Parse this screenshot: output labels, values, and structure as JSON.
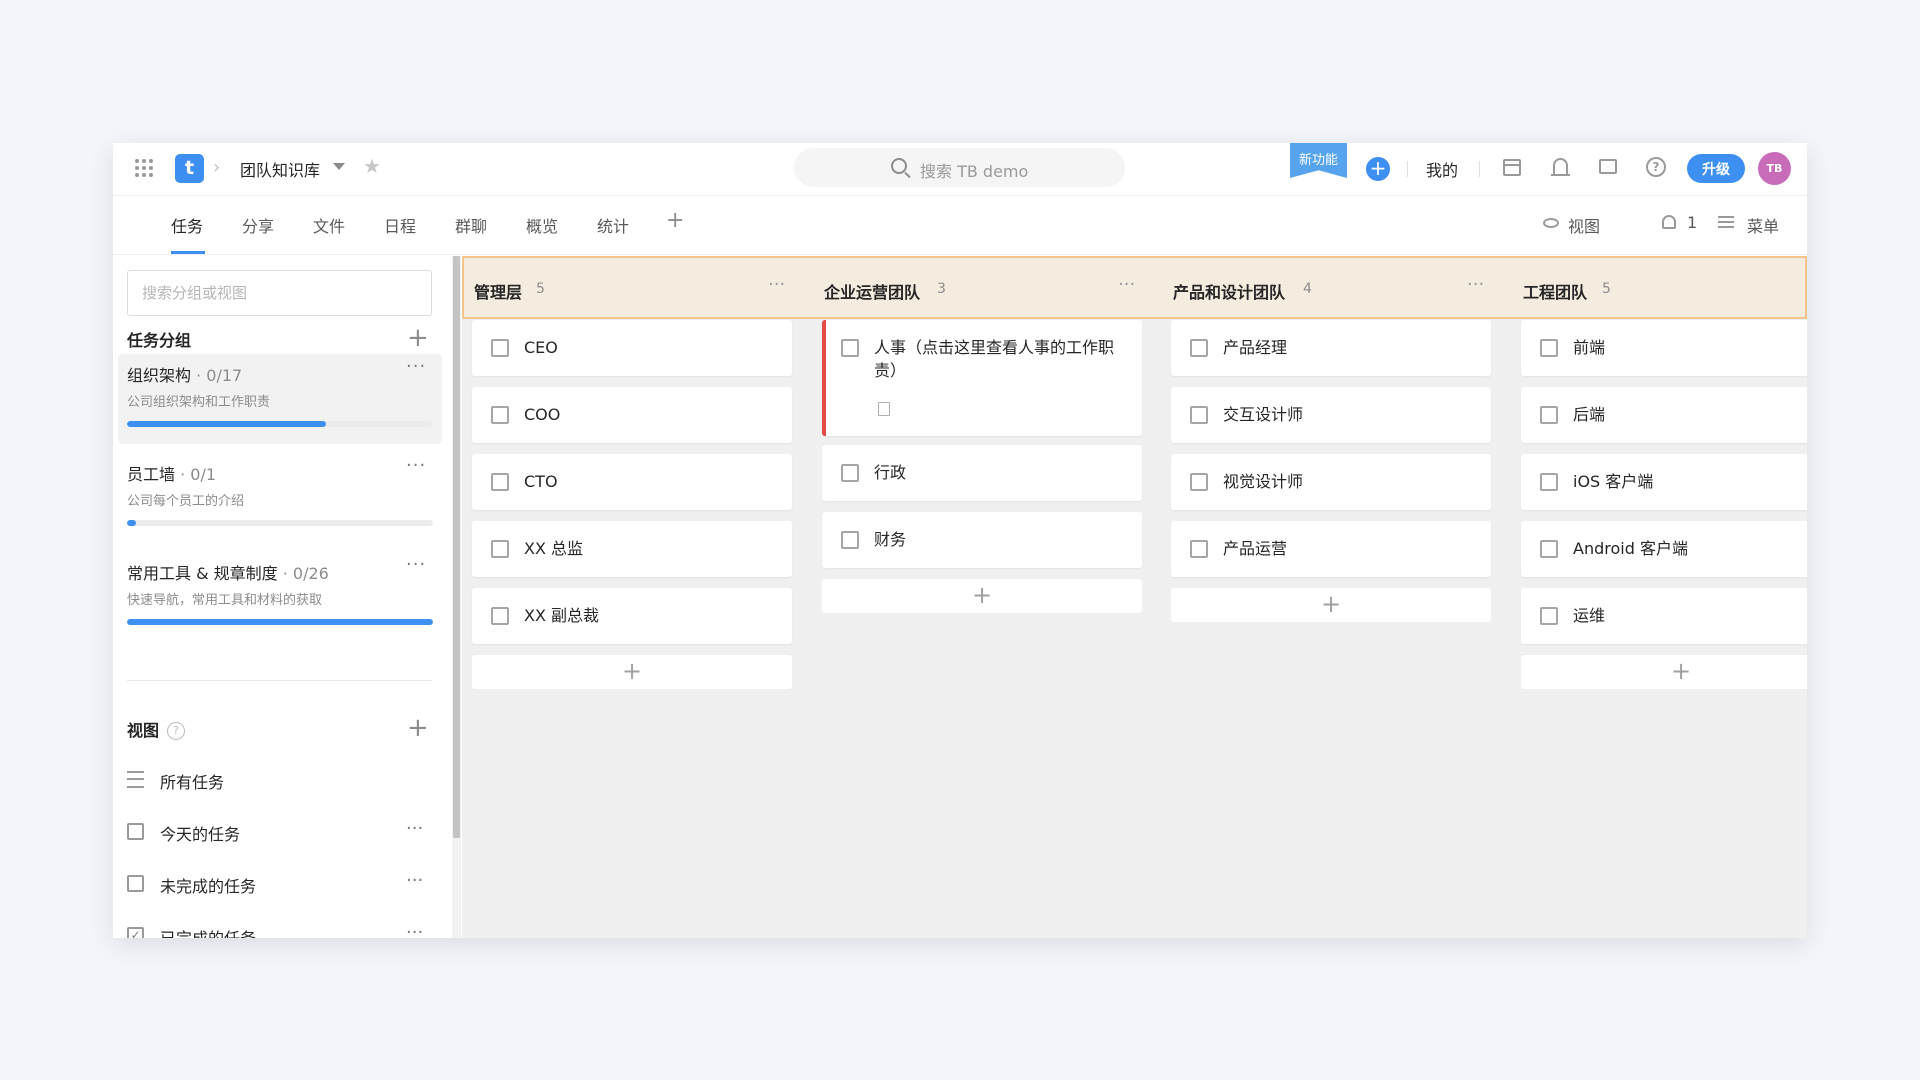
{
  "topbar": {
    "project_name": "团队知识库",
    "search_placeholder": "搜索 TB demo",
    "new_feature": "新功能",
    "add": "+",
    "mine": "我的",
    "help": "?",
    "upgrade": "升级",
    "avatar": "TB",
    "logo": "t"
  },
  "tabs": [
    {
      "label": "任务"
    },
    {
      "label": "分享"
    },
    {
      "label": "文件"
    },
    {
      "label": "日程"
    },
    {
      "label": "群聊"
    },
    {
      "label": "概览"
    },
    {
      "label": "统计"
    }
  ],
  "tab_controls": {
    "add": "+",
    "view": "视图",
    "members": "1",
    "menu": "菜单"
  },
  "sidebar": {
    "search_placeholder": "搜索分组或视图",
    "groups_title": "任务分组",
    "groups": [
      {
        "name": "组织架构",
        "count": "· 0/17",
        "desc": "公司组织架构和工作职责",
        "progress": 0.65
      },
      {
        "name": "员工墙",
        "count": "· 0/1",
        "desc": "公司每个员工的介绍",
        "progress": 0.03
      },
      {
        "name": "常用工具 & 规章制度",
        "count": "· 0/26",
        "desc": "快速导航，常用工具和材料的获取",
        "progress": 1.0
      }
    ],
    "views_title": "视图",
    "views": [
      {
        "label": "所有任务"
      },
      {
        "label": "今天的任务"
      },
      {
        "label": "未完成的任务"
      },
      {
        "label": "已完成的任务"
      }
    ]
  },
  "board": {
    "columns": [
      {
        "title": "管理层",
        "count": "5",
        "cards": [
          "CEO",
          "COO",
          "CTO",
          "XX 总监",
          "XX 副总裁"
        ]
      },
      {
        "title": "企业运营团队",
        "count": "3",
        "cards": [
          "人事（点击这里查看人事的工作职责）",
          "行政",
          "财务"
        ]
      },
      {
        "title": "产品和设计团队",
        "count": "4",
        "cards": [
          "产品经理",
          "交互设计师",
          "视觉设计师",
          "产品运营"
        ]
      },
      {
        "title": "工程团队",
        "count": "5",
        "cards": [
          "前端",
          "后端",
          "iOS 客户端",
          "Android 客户端",
          "运维"
        ]
      }
    ],
    "add": "+",
    "more": "···"
  }
}
